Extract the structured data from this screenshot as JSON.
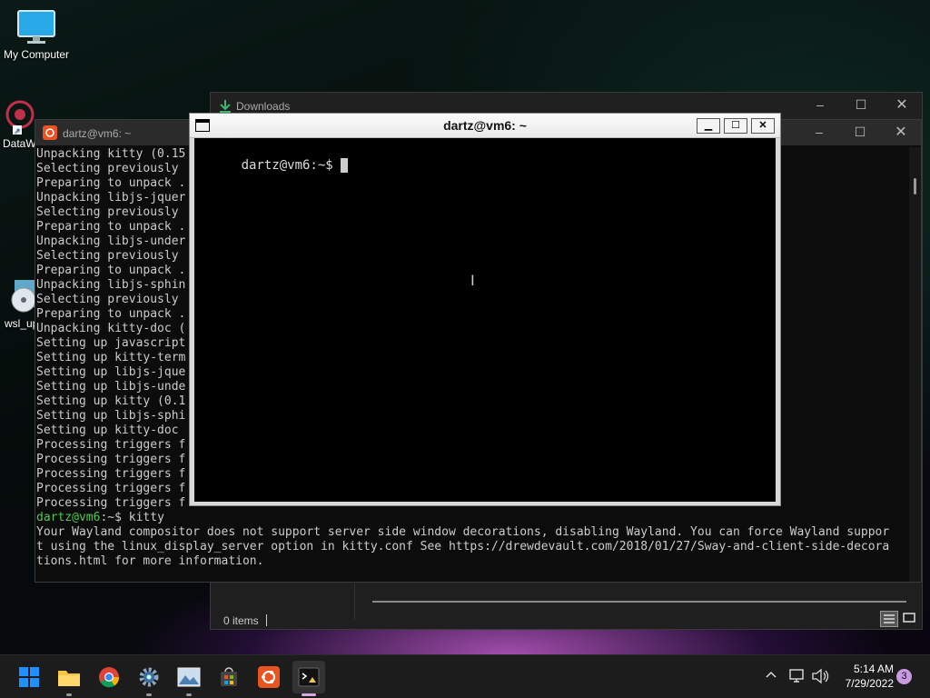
{
  "desktop": {
    "icons": [
      {
        "label": "My Computer"
      },
      {
        "label": "DataW"
      },
      {
        "label": "wsl_up"
      }
    ]
  },
  "downloads_window": {
    "title": "Downloads",
    "status": "0 items"
  },
  "back_terminal": {
    "title": "dartz@vm6: ~",
    "lines": [
      "Unpacking kitty (0.15",
      "Selecting previously",
      "Preparing to unpack .",
      "Unpacking libjs-jquer",
      "Selecting previously",
      "Preparing to unpack .",
      "Unpacking libjs-under",
      "Selecting previously",
      "Preparing to unpack .",
      "Unpacking libjs-sphin",
      "Selecting previously",
      "Preparing to unpack .",
      "Unpacking kitty-doc (",
      "Setting up javascript",
      "Setting up kitty-term",
      "Setting up libjs-jque",
      "Setting up libjs-unde",
      "Setting up kitty (0.1",
      "Setting up libjs-sphi",
      "Setting up kitty-doc",
      "Processing triggers f",
      "Processing triggers f",
      "Processing triggers f",
      "Processing triggers f",
      "Processing triggers f"
    ],
    "prompt_user": "dartz@vm6",
    "prompt_path": ":~$ kitty",
    "message_lines": [
      "Your Wayland compositor does not support server side window decorations, disabling Wayland. You can force Wayland suppor",
      "t using the linux_display_server option in kitty.conf See https://drewdevault.com/2018/01/27/Sway-and-client-side-decora",
      "tions.html for more information."
    ]
  },
  "kitty_window": {
    "title": "dartz@vm6: ~",
    "prompt": "dartz@vm6:~$ "
  },
  "taskbar": {
    "time": "5:14 AM",
    "date": "7/29/2022",
    "notification_count": "3",
    "apps": [
      "start-icon",
      "file-explorer-icon",
      "chrome-icon",
      "settings-icon",
      "photos-icon",
      "store-icon",
      "ubuntu-icon",
      "terminal-icon"
    ]
  },
  "colors": {
    "prompt_green": "#4ec94e",
    "accent": "#0078d4"
  }
}
